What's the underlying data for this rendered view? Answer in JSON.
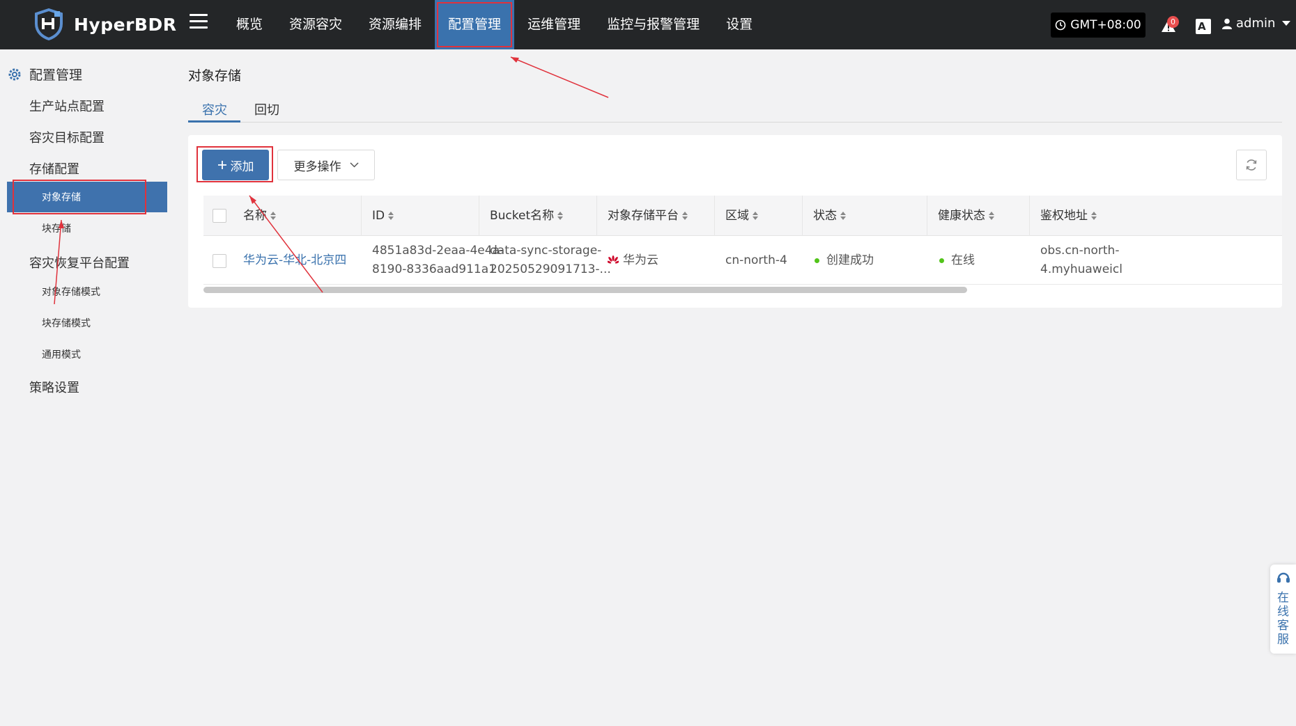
{
  "brand": {
    "name": "HyperBDR"
  },
  "nav": {
    "items": [
      {
        "label": "概览",
        "active": false
      },
      {
        "label": "资源容灾",
        "active": false
      },
      {
        "label": "资源编排",
        "active": false
      },
      {
        "label": "配置管理",
        "active": true
      },
      {
        "label": "运维管理",
        "active": false
      },
      {
        "label": "监控与报警管理",
        "active": false
      },
      {
        "label": "设置",
        "active": false
      }
    ]
  },
  "header": {
    "timezone": "GMT+08:00",
    "alert_count": "0",
    "user": "admin"
  },
  "sidebar": {
    "title": "配置管理",
    "items": [
      {
        "label": "生产站点配置"
      },
      {
        "label": "容灾目标配置"
      },
      {
        "label": "存储配置"
      },
      {
        "label": "对象存储",
        "active": true
      },
      {
        "label": "块存储"
      },
      {
        "label": "容灾恢复平台配置"
      },
      {
        "label": "对象存储模式"
      },
      {
        "label": "块存储模式"
      },
      {
        "label": "通用模式"
      },
      {
        "label": "策略设置"
      }
    ]
  },
  "main": {
    "title": "对象存储",
    "tabs": [
      {
        "label": "容灾",
        "active": true
      },
      {
        "label": "回切",
        "active": false
      }
    ],
    "toolbar": {
      "add_label": "添加",
      "more_label": "更多操作"
    },
    "table": {
      "columns": [
        "名称",
        "ID",
        "Bucket名称",
        "对象存储平台",
        "区域",
        "状态",
        "健康状态",
        "鉴权地址"
      ],
      "rows": [
        {
          "name": "华为云-华北-北京四",
          "id_line1": "4851a83d-2eaa-4e4a-",
          "id_line2": "8190-8336aad911a1",
          "bucket_line1": "data-sync-storage-",
          "bucket_line2": "20250529091713-...",
          "platform": "华为云",
          "region": "cn-north-4",
          "status": "创建成功",
          "health": "在线",
          "auth_line1": "obs.cn-north-",
          "auth_line2": "4.myhuaweicl"
        }
      ]
    }
  },
  "support": {
    "label": "在线客服"
  },
  "colors": {
    "accent": "#3f72ad",
    "topbar": "#242628",
    "highlight": "#e0323c",
    "success": "#52c41a",
    "huawei": "#cf0a2c"
  }
}
